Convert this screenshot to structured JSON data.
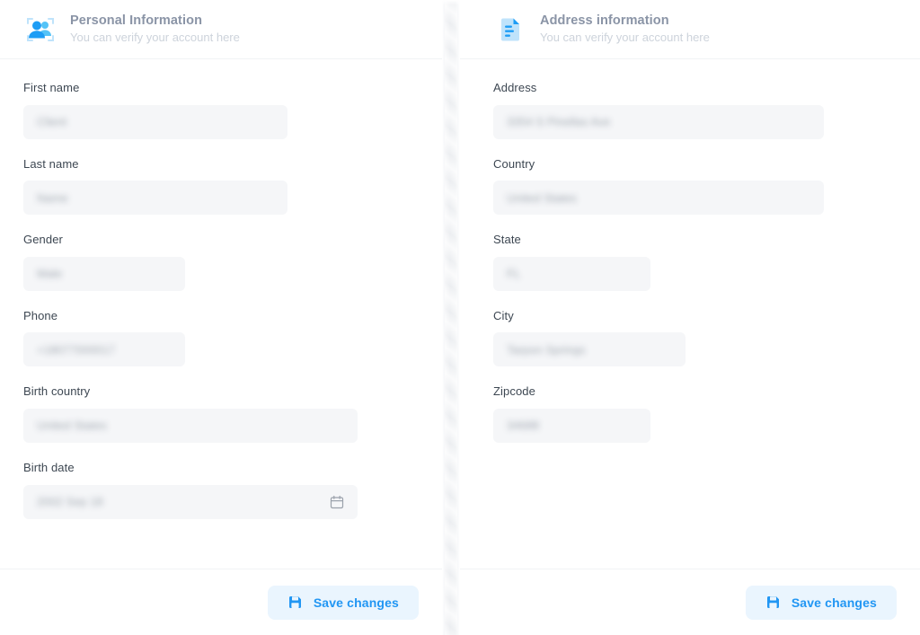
{
  "theme": {
    "accent": "#2196f3",
    "button_bg": "#eaf5fe",
    "input_bg": "#f5f6f8",
    "title_color": "#8a94a6",
    "subtitle_color": "#cdd3db",
    "label_color": "#3d4752",
    "divider_color": "#f1f3f5",
    "page_bg": "#ffffff"
  },
  "panels": [
    {
      "id": "personal-information",
      "icon": "users-scan-icon",
      "title": "Personal Information",
      "subtitle": "You can verify your account here",
      "fields": [
        {
          "label": "First name",
          "value": "Client",
          "width": "w-294",
          "icon": null
        },
        {
          "label": "Last name",
          "value": "Name",
          "width": "w-294",
          "icon": null
        },
        {
          "label": "Gender",
          "value": "Male",
          "width": "w-180",
          "icon": null
        },
        {
          "label": "Phone",
          "value": "+18077000017",
          "width": "w-180",
          "icon": null
        },
        {
          "label": "Birth country",
          "value": "United States",
          "width": "w-372",
          "icon": null
        },
        {
          "label": "Birth date",
          "value": "2002 Sep 18",
          "width": "w-372",
          "icon": "calendar-icon"
        }
      ],
      "save_label": "Save changes",
      "save_icon": "floppy-save-icon"
    },
    {
      "id": "address-information",
      "icon": "document-lines-icon",
      "title": "Address information",
      "subtitle": "You can verify your account here",
      "fields": [
        {
          "label": "Address",
          "value": "3354 S Pinellas Ave",
          "width": "w-368",
          "icon": null
        },
        {
          "label": "Country",
          "value": "United States",
          "width": "w-368",
          "icon": null
        },
        {
          "label": "State",
          "value": "FL",
          "width": "w-175",
          "icon": null
        },
        {
          "label": "City",
          "value": "Tarpon Springs",
          "width": "w-214",
          "icon": null
        },
        {
          "label": "Zipcode",
          "value": "34688",
          "width": "w-175",
          "icon": null
        }
      ],
      "save_label": "Save changes",
      "save_icon": "floppy-save-icon"
    }
  ]
}
